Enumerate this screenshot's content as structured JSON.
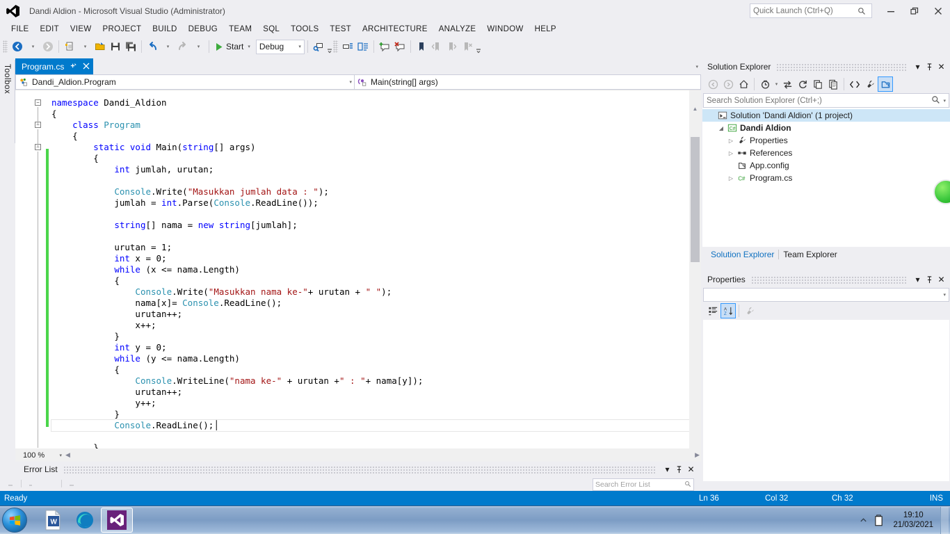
{
  "window": {
    "title": "Dandi Aldion - Microsoft Visual Studio (Administrator)",
    "logo_icon": "visual-studio-logo",
    "minimize_icon": "minimize-icon",
    "maximize_icon": "restore-icon",
    "close_icon": "close-icon",
    "minimize_glyph": "—",
    "maximize_glyph": "❐",
    "close_glyph": "✕"
  },
  "quick_launch": {
    "placeholder": "Quick Launch (Ctrl+Q)",
    "value": "",
    "icon": "search-icon"
  },
  "menu": {
    "items": [
      "FILE",
      "EDIT",
      "VIEW",
      "PROJECT",
      "BUILD",
      "DEBUG",
      "TEAM",
      "SQL",
      "TOOLS",
      "TEST",
      "ARCHITECTURE",
      "ANALYZE",
      "WINDOW",
      "HELP"
    ]
  },
  "toolbar": {
    "navigate_back_icon": "navigate-back-icon",
    "navigate_forward_icon": "navigate-forward-icon",
    "new_project_icon": "new-project-icon",
    "open_file_icon": "open-file-icon",
    "save_icon": "save-icon",
    "save_all_icon": "save-all-icon",
    "undo_icon": "undo-icon",
    "redo_icon": "redo-icon",
    "start_icon": "start-play-icon",
    "start_label": "Start",
    "configuration": "Debug",
    "attach_icon": "attach-to-process-icon",
    "step_into_icon": "step-into-icon",
    "step_over_icon": "step-over-icon",
    "add_comment_icon": "add-comment-icon",
    "remove_comment_icon": "remove-comment-icon",
    "bookmark_icon": "bookmark-icon",
    "prev_bookmark_icon": "previous-bookmark-icon",
    "next_bookmark_icon": "next-bookmark-icon",
    "clear_bookmarks_icon": "clear-bookmarks-icon",
    "overflow_icon": "toolbar-overflow-icon",
    "dropdown_glyph": "▾"
  },
  "toolbox": {
    "label": "Toolbox"
  },
  "editor": {
    "tab": {
      "label": "Program.cs",
      "pin_glyph": "−◢",
      "close_glyph": "✕"
    },
    "tab_dropdown_glyph": "▾",
    "navbar": {
      "type_icon": "class-members-icon",
      "type_value": "Dandi_Aldion.Program",
      "member_icon": "method-icon",
      "member_value": "Main(string[] args)",
      "dropdown_glyph": "▾"
    },
    "zoom": "100 %",
    "zoom_dropdown_glyph": "▾",
    "splitter_icon": "split-view-icon",
    "code": [
      {
        "indent": 0,
        "fold": "minus",
        "parts": [
          {
            "t": "namespace ",
            "c": "kw"
          },
          {
            "t": "Dandi_Aldion",
            "c": ""
          }
        ]
      },
      {
        "indent": 0,
        "fold": "",
        "parts": [
          {
            "t": "{",
            "c": ""
          }
        ]
      },
      {
        "indent": 1,
        "fold": "minus",
        "parts": [
          {
            "t": "class ",
            "c": "kw"
          },
          {
            "t": "Program",
            "c": "type"
          }
        ]
      },
      {
        "indent": 1,
        "fold": "",
        "parts": [
          {
            "t": "{",
            "c": ""
          }
        ]
      },
      {
        "indent": 2,
        "fold": "minus",
        "parts": [
          {
            "t": "static ",
            "c": "kw"
          },
          {
            "t": "void ",
            "c": "kw"
          },
          {
            "t": "Main(",
            "c": ""
          },
          {
            "t": "string",
            "c": "kw"
          },
          {
            "t": "[] args)",
            "c": ""
          }
        ]
      },
      {
        "indent": 2,
        "fold": "",
        "parts": [
          {
            "t": "{",
            "c": ""
          }
        ]
      },
      {
        "indent": 3,
        "fold": "",
        "parts": [
          {
            "t": "int ",
            "c": "kw"
          },
          {
            "t": "jumlah, urutan;",
            "c": ""
          }
        ]
      },
      {
        "indent": 3,
        "fold": "",
        "parts": [
          {
            "t": "",
            "c": ""
          }
        ]
      },
      {
        "indent": 3,
        "fold": "",
        "parts": [
          {
            "t": "Console",
            "c": "type"
          },
          {
            "t": ".Write(",
            "c": ""
          },
          {
            "t": "\"Masukkan jumlah data : \"",
            "c": "str"
          },
          {
            "t": ");",
            "c": ""
          }
        ]
      },
      {
        "indent": 3,
        "fold": "",
        "parts": [
          {
            "t": "jumlah = ",
            "c": ""
          },
          {
            "t": "int",
            "c": "kw"
          },
          {
            "t": ".Parse(",
            "c": ""
          },
          {
            "t": "Console",
            "c": "type"
          },
          {
            "t": ".ReadLine());",
            "c": ""
          }
        ]
      },
      {
        "indent": 3,
        "fold": "",
        "parts": [
          {
            "t": "",
            "c": ""
          }
        ]
      },
      {
        "indent": 3,
        "fold": "",
        "parts": [
          {
            "t": "string",
            "c": "kw"
          },
          {
            "t": "[] nama = ",
            "c": ""
          },
          {
            "t": "new ",
            "c": "kw"
          },
          {
            "t": "string",
            "c": "kw"
          },
          {
            "t": "[jumlah];",
            "c": ""
          }
        ]
      },
      {
        "indent": 3,
        "fold": "",
        "parts": [
          {
            "t": "",
            "c": ""
          }
        ]
      },
      {
        "indent": 3,
        "fold": "",
        "parts": [
          {
            "t": "urutan = 1;",
            "c": ""
          }
        ]
      },
      {
        "indent": 3,
        "fold": "",
        "parts": [
          {
            "t": "int ",
            "c": "kw"
          },
          {
            "t": "x = 0;",
            "c": ""
          }
        ]
      },
      {
        "indent": 3,
        "fold": "",
        "parts": [
          {
            "t": "while ",
            "c": "kw"
          },
          {
            "t": "(x <= nama.Length)",
            "c": ""
          }
        ]
      },
      {
        "indent": 3,
        "fold": "",
        "parts": [
          {
            "t": "{",
            "c": ""
          }
        ]
      },
      {
        "indent": 4,
        "fold": "",
        "parts": [
          {
            "t": "Console",
            "c": "type"
          },
          {
            "t": ".Write(",
            "c": ""
          },
          {
            "t": "\"Masukkan nama ke-\"",
            "c": "str"
          },
          {
            "t": "+ urutan + ",
            "c": ""
          },
          {
            "t": "\" \"",
            "c": "str"
          },
          {
            "t": ");",
            "c": ""
          }
        ]
      },
      {
        "indent": 4,
        "fold": "",
        "parts": [
          {
            "t": "nama[x]= ",
            "c": ""
          },
          {
            "t": "Console",
            "c": "type"
          },
          {
            "t": ".ReadLine();",
            "c": ""
          }
        ]
      },
      {
        "indent": 4,
        "fold": "",
        "parts": [
          {
            "t": "urutan++;",
            "c": ""
          }
        ]
      },
      {
        "indent": 4,
        "fold": "",
        "parts": [
          {
            "t": "x++;",
            "c": ""
          }
        ]
      },
      {
        "indent": 3,
        "fold": "",
        "parts": [
          {
            "t": "}",
            "c": ""
          }
        ]
      },
      {
        "indent": 3,
        "fold": "",
        "parts": [
          {
            "t": "int ",
            "c": "kw"
          },
          {
            "t": "y = 0;",
            "c": ""
          }
        ]
      },
      {
        "indent": 3,
        "fold": "",
        "parts": [
          {
            "t": "while ",
            "c": "kw"
          },
          {
            "t": "(y <= nama.Length)",
            "c": ""
          }
        ]
      },
      {
        "indent": 3,
        "fold": "",
        "parts": [
          {
            "t": "{",
            "c": ""
          }
        ]
      },
      {
        "indent": 4,
        "fold": "",
        "parts": [
          {
            "t": "Console",
            "c": "type"
          },
          {
            "t": ".WriteLine(",
            "c": ""
          },
          {
            "t": "\"nama ke-\"",
            "c": "str"
          },
          {
            "t": " + urutan +",
            "c": ""
          },
          {
            "t": "\" : \"",
            "c": "str"
          },
          {
            "t": "+ nama[y]);",
            "c": ""
          }
        ]
      },
      {
        "indent": 4,
        "fold": "",
        "parts": [
          {
            "t": "urutan++;",
            "c": ""
          }
        ]
      },
      {
        "indent": 4,
        "fold": "",
        "parts": [
          {
            "t": "y++;",
            "c": ""
          }
        ]
      },
      {
        "indent": 3,
        "fold": "",
        "parts": [
          {
            "t": "}",
            "c": ""
          }
        ]
      },
      {
        "indent": 3,
        "fold": "",
        "parts": [
          {
            "t": "Console",
            "c": "type"
          },
          {
            "t": ".ReadLine();",
            "c": ""
          }
        ],
        "current": true
      },
      {
        "indent": 3,
        "fold": "",
        "parts": [
          {
            "t": "",
            "c": ""
          }
        ]
      },
      {
        "indent": 2,
        "fold": "",
        "parts": [
          {
            "t": "}",
            "c": ""
          }
        ]
      }
    ]
  },
  "error_list": {
    "title": "Error List",
    "dropdown_glyph": "▾",
    "pin_glyph": "⏐",
    "close_glyph": "✕",
    "search_placeholder": "Search Error List",
    "search_icon": "search-icon"
  },
  "solution_explorer": {
    "title": "Solution Explorer",
    "dropdown_glyph": "▾",
    "pin_glyph": "⏐",
    "close_glyph": "✕",
    "toolbar_icons": [
      "back-icon",
      "forward-icon",
      "home-icon",
      "pending-changes-icon",
      "sync-with-active-document-icon",
      "refresh-icon",
      "collapse-all-icon",
      "show-all-files-icon",
      "view-code-icon",
      "properties-wrench-icon",
      "preview-selected-items-icon"
    ],
    "search": {
      "placeholder": "Search Solution Explorer (Ctrl+;)",
      "value": "",
      "icon": "search-icon",
      "dropdown_glyph": "▾"
    },
    "tree": [
      {
        "label": "Solution 'Dandi Aldion' (1 project)",
        "icon": "solution-icon",
        "expander": "",
        "depth": 0,
        "selected": true,
        "bold": false
      },
      {
        "label": "Dandi Aldion",
        "icon": "csharp-project-icon",
        "expander": "◢",
        "depth": 1,
        "selected": false,
        "bold": true
      },
      {
        "label": "Properties",
        "icon": "properties-wrench-icon",
        "expander": "▷",
        "depth": 2,
        "selected": false,
        "bold": false
      },
      {
        "label": "References",
        "icon": "references-icon",
        "expander": "▷",
        "depth": 2,
        "selected": false,
        "bold": false
      },
      {
        "label": "App.config",
        "icon": "config-file-icon",
        "expander": "",
        "depth": 2,
        "selected": false,
        "bold": false
      },
      {
        "label": "Program.cs",
        "icon": "csharp-file-icon",
        "expander": "▷",
        "depth": 2,
        "selected": false,
        "bold": false
      }
    ],
    "tabs": [
      {
        "label": "Solution Explorer",
        "active": true
      },
      {
        "label": "Team Explorer",
        "active": false
      }
    ]
  },
  "properties_panel": {
    "title": "Properties",
    "dropdown_glyph": "▾",
    "pin_glyph": "⏐",
    "close_glyph": "✕",
    "object_value": "",
    "object_dropdown_glyph": "▾",
    "categorized_icon": "categorized-view-icon",
    "alphabetical_icon": "alphabetical-sort-icon",
    "property_pages_icon": "property-pages-wrench-icon"
  },
  "status_bar": {
    "ready": "Ready",
    "line": "Ln 36",
    "column": "Col 32",
    "character": "Ch 32",
    "insert_mode": "INS",
    "accent": "#007acc"
  },
  "taskbar": {
    "start_icon": "windows-start-orb",
    "items": [
      {
        "icon": "microsoft-word-icon",
        "active": false
      },
      {
        "icon": "microsoft-edge-icon",
        "active": false
      },
      {
        "icon": "visual-studio-icon",
        "active": true
      }
    ],
    "tray": {
      "show_hidden_icon": "show-hidden-icons-chevron",
      "battery_icon": "battery-icon"
    },
    "clock": {
      "time": "19:10",
      "date": "21/03/2021"
    }
  },
  "colors": {
    "accent_blue": "#007acc",
    "chrome": "#eeeef2",
    "keyword": "#0000ff",
    "type": "#2b91af",
    "string": "#a31515",
    "change_bar_green": "#4bd64b",
    "selection": "#cde6f7"
  }
}
